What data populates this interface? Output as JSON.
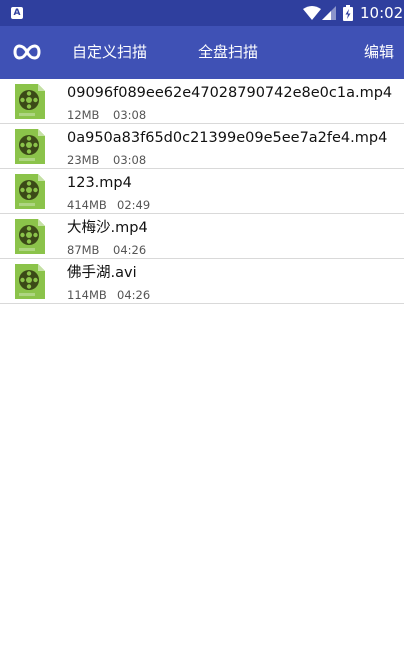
{
  "status_bar": {
    "time": "10:02",
    "notification_icon": "A"
  },
  "toolbar": {
    "logo_icon": "infinity-logo-icon",
    "custom_scan_label": "自定义扫描",
    "full_scan_label": "全盘扫描",
    "edit_label": "编辑"
  },
  "colors": {
    "status_bar": "#2f3f9e",
    "toolbar": "#3f51b5",
    "file_icon_green": "#8bc34a"
  },
  "files": [
    {
      "name": "09096f089ee62e47028790742e8e0c1a.mp4",
      "size": "12MB",
      "duration": "03:08"
    },
    {
      "name": "0a950a83f65d0c21399e09e5ee7a2fe4.mp4",
      "size": "23MB",
      "duration": "03:08"
    },
    {
      "name": "123.mp4",
      "size": "414MB",
      "duration": "02:49"
    },
    {
      "name": "大梅沙.mp4",
      "size": "87MB",
      "duration": "04:26"
    },
    {
      "name": "佛手湖.avi",
      "size": "114MB",
      "duration": "04:26"
    }
  ]
}
